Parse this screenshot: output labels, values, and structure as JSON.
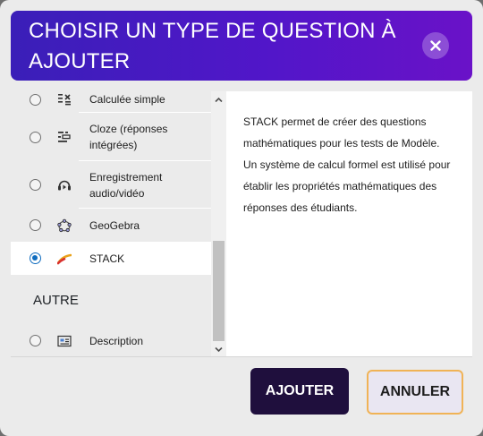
{
  "header": {
    "title": "CHOISIR UN TYPE DE QUESTION À AJOUTER"
  },
  "list": {
    "items": [
      {
        "label": "Calculée simple",
        "selected": false,
        "icon": "calculator-icon"
      },
      {
        "label": "Cloze (réponses intégrées)",
        "selected": false,
        "icon": "cloze-icon"
      },
      {
        "label": "Enregistrement audio/vidéo",
        "selected": false,
        "icon": "headset-icon"
      },
      {
        "label": "GeoGebra",
        "selected": false,
        "icon": "geogebra-icon"
      },
      {
        "label": "STACK",
        "selected": true,
        "icon": "stack-icon"
      }
    ],
    "other_section": {
      "title": "AUTRE",
      "items": [
        {
          "label": "Description",
          "selected": false,
          "icon": "description-icon"
        }
      ]
    }
  },
  "description": {
    "text": "STACK permet de créer des questions mathématiques pour les tests de Modèle. Un système de calcul formel est utilisé pour établir les propriétés mathématiques des réponses des étudiants."
  },
  "buttons": {
    "add": "AJOUTER",
    "cancel": "ANNULER"
  },
  "colors": {
    "header_gradient_start": "#3a1fb8",
    "header_gradient_end": "#6a12c8",
    "primary_button": "#1f0f3d",
    "radio_selected": "#0f6cbf",
    "cancel_border": "#f0b356"
  }
}
